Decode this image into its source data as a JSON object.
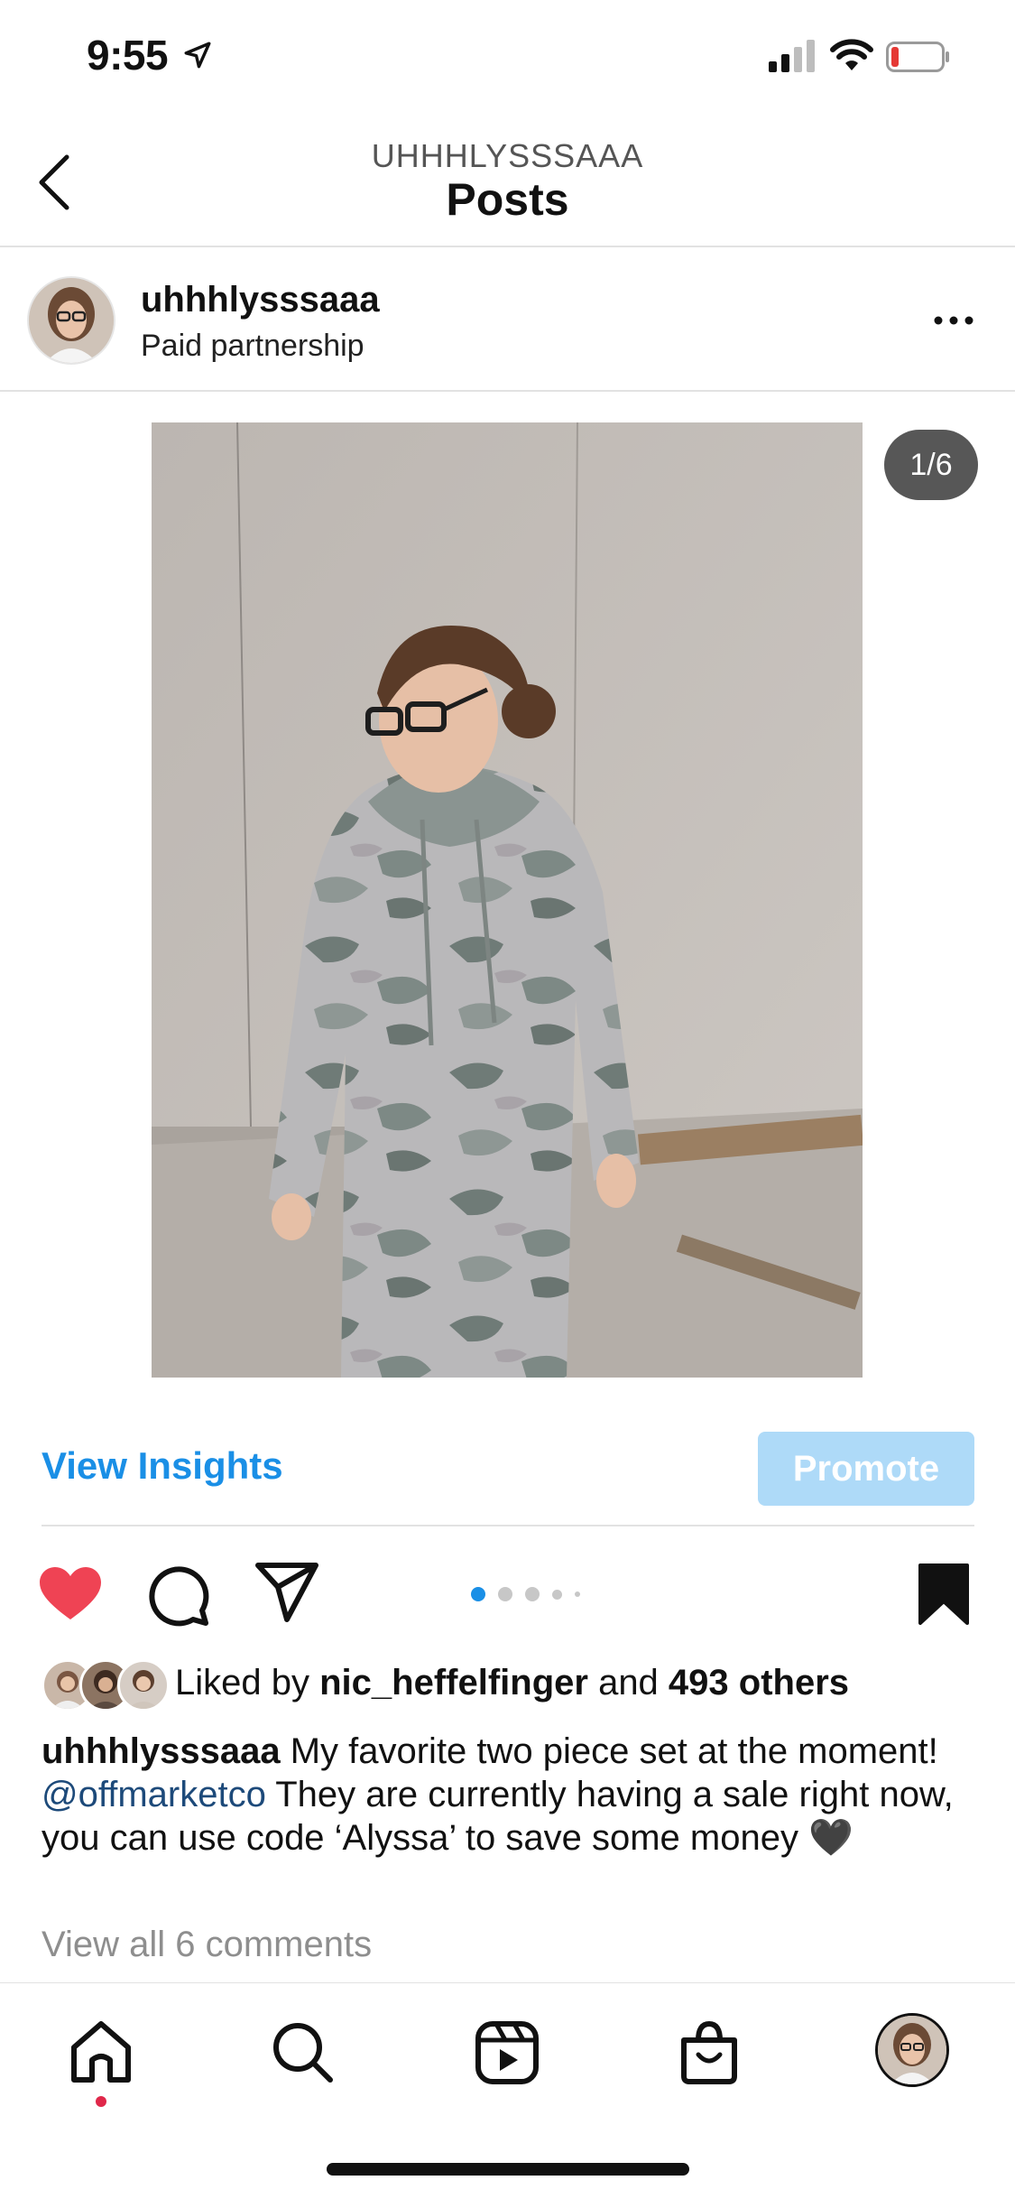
{
  "status_bar": {
    "time": "9:55"
  },
  "header": {
    "account": "UHHHLYSSSAAA",
    "title": "Posts"
  },
  "post": {
    "username": "uhhhlysssaaa",
    "label": "Paid partnership",
    "image_counter": "1/6",
    "carousel": {
      "total": 6,
      "current": 1
    },
    "view_insights": "View Insights",
    "promote": "Promote",
    "likes": {
      "prefix": "Liked by ",
      "user": "nic_heffelfinger",
      "middle": " and ",
      "others": "493 others"
    },
    "caption": {
      "author": "uhhhlysssaaa",
      "text_before": " My favorite two piece set at the moment! ",
      "mention": "@offmarketco",
      "text_after": " They are currently having a sale right now, you can use code ‘Alyssa’ to save some money 🖤"
    },
    "view_comments": "View all 6 comments"
  },
  "colors": {
    "accent": "#1a8fe6",
    "like": "#ef4354",
    "promote_bg": "#aedaf8",
    "mention": "#1d4a7a"
  },
  "tabs": [
    "home-icon",
    "search-icon",
    "reels-icon",
    "shop-icon",
    "profile-avatar"
  ]
}
